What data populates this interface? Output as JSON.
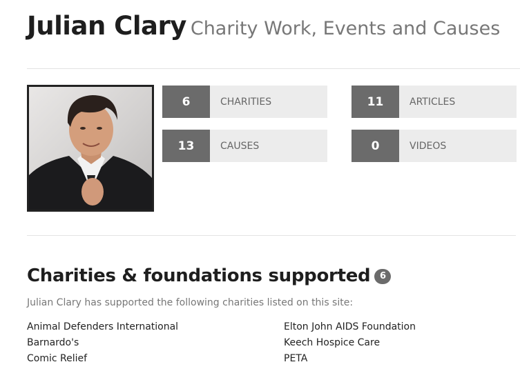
{
  "header": {
    "name": "Julian Clary",
    "subtitle": "Charity Work, Events and Causes"
  },
  "stats": [
    {
      "count": "6",
      "label": "CHARITIES"
    },
    {
      "count": "11",
      "label": "ARTICLES"
    },
    {
      "count": "13",
      "label": "CAUSES"
    },
    {
      "count": "0",
      "label": "VIDEOS"
    }
  ],
  "charities_section": {
    "heading": "Charities & foundations supported",
    "badge": "6",
    "intro": "Julian Clary has supported the following charities listed on this site:",
    "left": [
      "Animal Defenders International",
      "Barnardo's",
      "Comic Relief"
    ],
    "right": [
      "Elton John AIDS Foundation",
      "Keech Hospice Care",
      "PETA"
    ]
  }
}
